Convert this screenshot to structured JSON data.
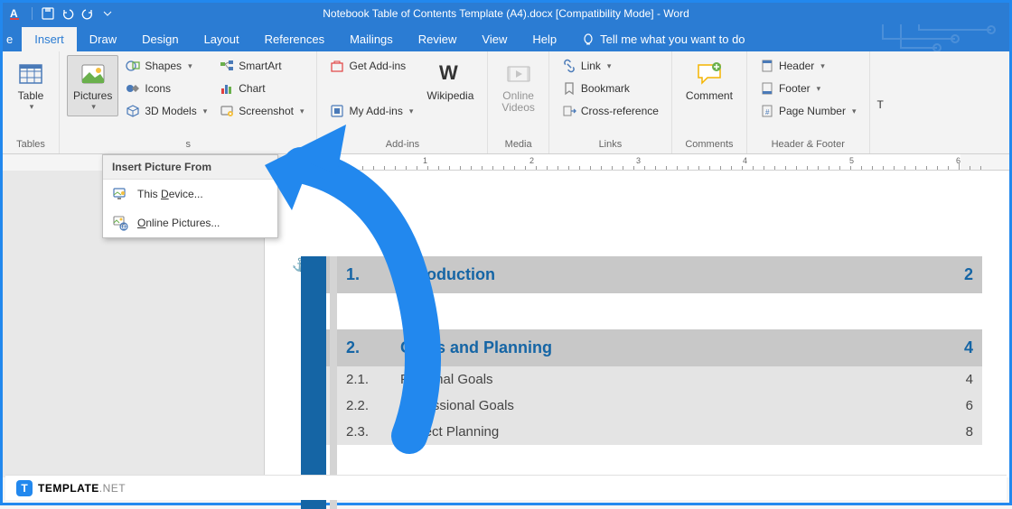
{
  "title": "Notebook Table of Contents Template (A4).docx [Compatibility Mode]  -  Word",
  "tabs": {
    "partial": "e",
    "insert": "Insert",
    "draw": "Draw",
    "design": "Design",
    "layout": "Layout",
    "references": "References",
    "mailings": "Mailings",
    "review": "Review",
    "view": "View",
    "help": "Help"
  },
  "tell_me": "Tell me what you want to do",
  "ribbon": {
    "tables": {
      "table": "Table",
      "label": "Tables"
    },
    "illus": {
      "pictures": "Pictures",
      "shapes": "Shapes",
      "icons": "Icons",
      "models": "3D Models",
      "smartart": "SmartArt",
      "chart": "Chart",
      "screenshot": "Screenshot",
      "label": "s"
    },
    "addins": {
      "get": "Get Add-ins",
      "my": "My Add-ins",
      "wiki": "Wikipedia",
      "label": "Add-ins"
    },
    "media": {
      "video": "Online\nVideos",
      "label": "Media"
    },
    "links": {
      "link": "Link",
      "bookmark": "Bookmark",
      "xref": "Cross-reference",
      "label": "Links"
    },
    "comments": {
      "comment": "Comment",
      "label": "Comments"
    },
    "headerfooter": {
      "header": "Header",
      "footer": "Footer",
      "pagenum": "Page Number",
      "label": "Header & Footer"
    }
  },
  "dropdown": {
    "title": "Insert Picture From",
    "device": "This ",
    "device_u": "D",
    "device_r": "evice...",
    "online_u": "O",
    "online_r": "nline Pictures..."
  },
  "ruler": {
    "marks": [
      "1",
      "2",
      "3",
      "4",
      "5",
      "6"
    ]
  },
  "toc": {
    "r1": {
      "num": "1.",
      "txt": "Introduction",
      "pg": "2"
    },
    "r2": {
      "num": "2.",
      "txt": "Goals and Planning",
      "pg": "4"
    },
    "r3": {
      "num": "2.1.",
      "txt": "Personal Goals",
      "pg": "4"
    },
    "r4": {
      "num": "2.2.",
      "txt": "Professional Goals",
      "pg": "6"
    },
    "r5": {
      "num": "2.3.",
      "txt": "Project Planning",
      "pg": "8"
    }
  },
  "footer": {
    "brand1": "TEMPLATE",
    "brand2": ".NET"
  }
}
